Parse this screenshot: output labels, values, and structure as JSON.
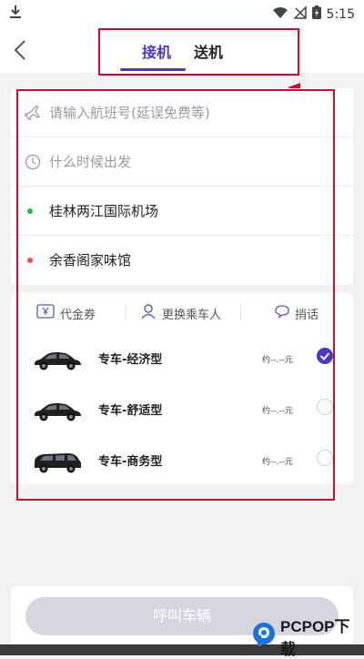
{
  "status_bar": {
    "time": "5:15"
  },
  "header": {
    "tabs": [
      {
        "label": "接机",
        "active": true
      },
      {
        "label": "送机",
        "active": false
      }
    ],
    "accent_color": "#4b38c8"
  },
  "form": {
    "flight_placeholder": "请输入航班号(延误免费等)",
    "time_placeholder": "什么时候出发",
    "pickup_location": "桂林两江国际机场",
    "dropoff_location": "余香阁家味馆"
  },
  "options": {
    "voucher_label": "代金券",
    "change_passenger_label": "更换乘车人",
    "message_label": "捎话"
  },
  "car_types": [
    {
      "name": "专车-经济型",
      "price": "约--.--元",
      "selected": true
    },
    {
      "name": "专车-舒适型",
      "price": "约--.--元",
      "selected": false
    },
    {
      "name": "专车-商务型",
      "price": "约--.--元",
      "selected": false
    }
  ],
  "call_button_label": "呼叫车辆",
  "watermark": {
    "text": "PCPOP下载",
    "icon": "pcpop-logo-icon"
  }
}
